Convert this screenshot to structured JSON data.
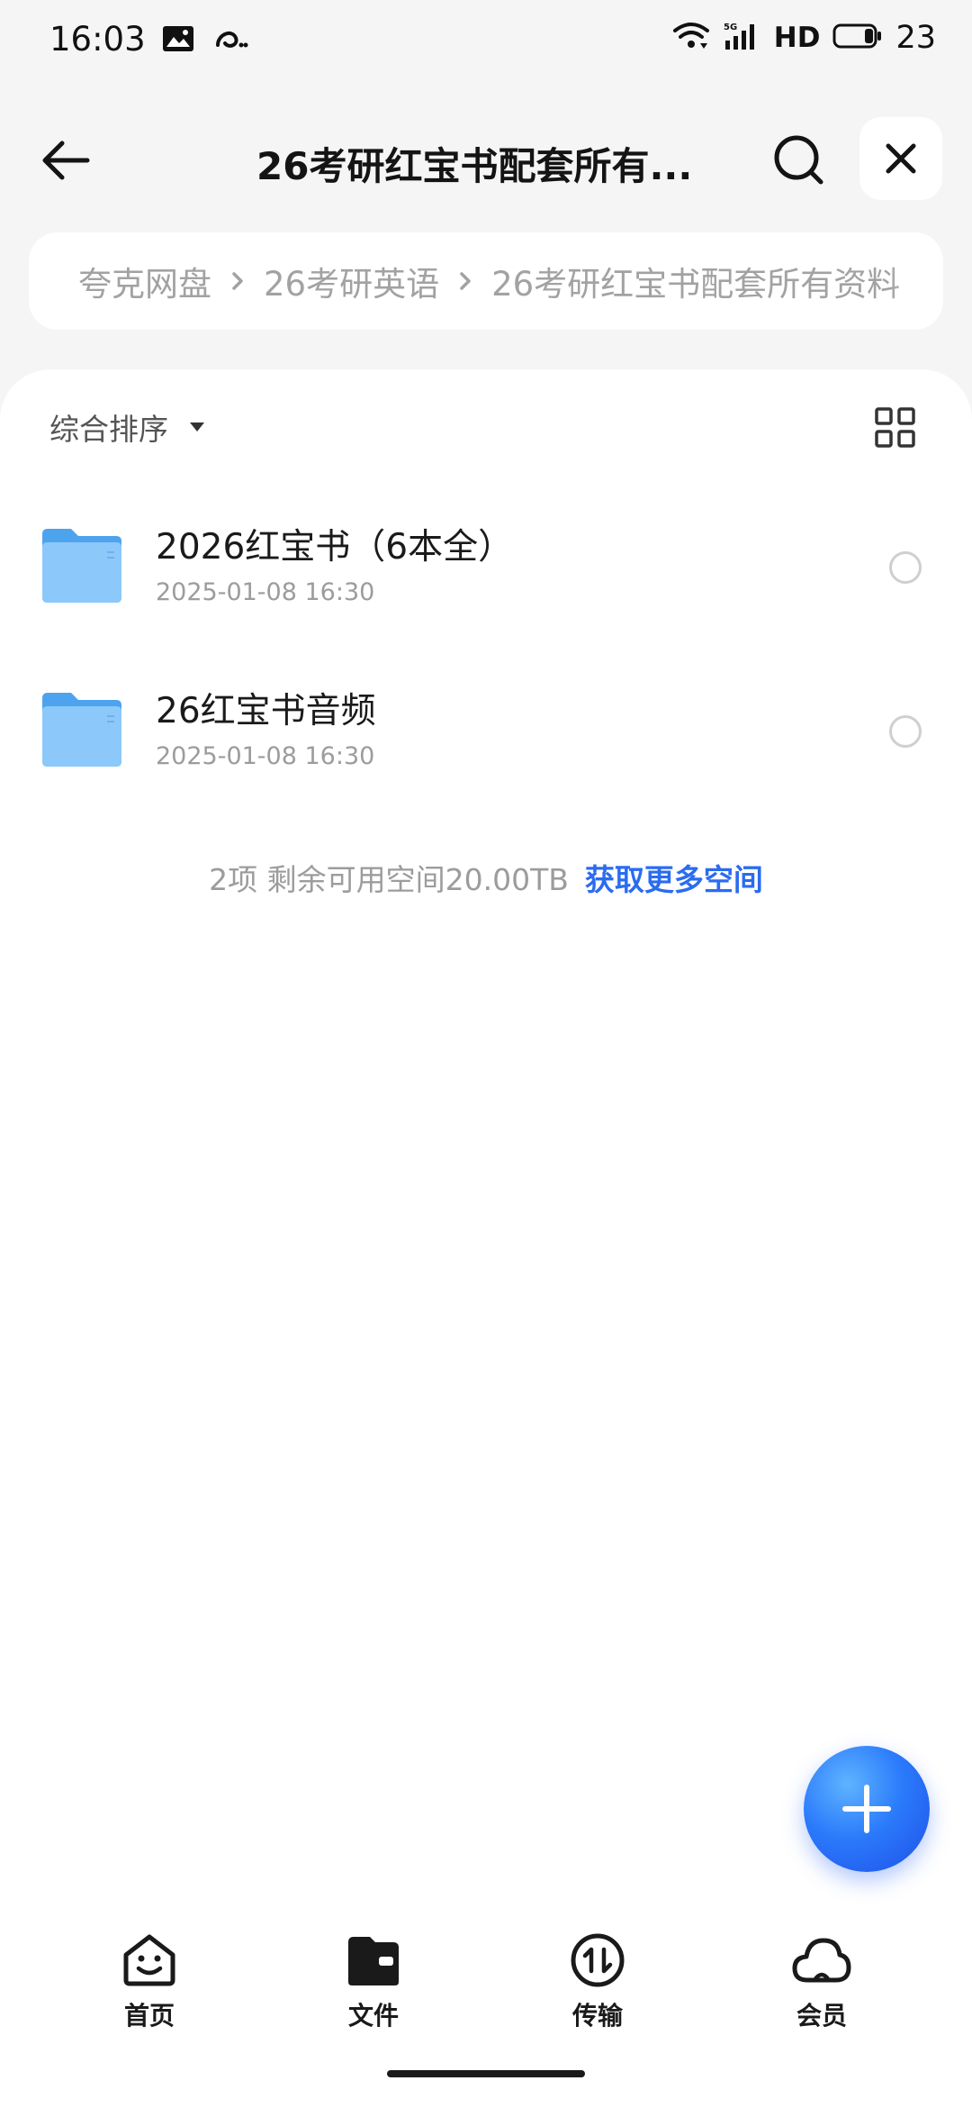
{
  "status_bar": {
    "time": "16:03",
    "network_label": "5G",
    "hd_label": "HD",
    "battery": "23"
  },
  "header": {
    "title": "26考研红宝书配套所有...",
    "back_icon": "arrow-left-icon",
    "search_icon": "search-icon",
    "close_icon": "close-icon"
  },
  "breadcrumb": {
    "items": [
      "夸克网盘",
      "26考研英语",
      "26考研红宝书配套所有资料"
    ]
  },
  "toolbar": {
    "sort_label": "综合排序"
  },
  "files": [
    {
      "name": "2026红宝书（6本全）",
      "date": "2025-01-08 16:30",
      "type": "folder"
    },
    {
      "name": "26红宝书音频",
      "date": "2025-01-08 16:30",
      "type": "folder"
    }
  ],
  "storage": {
    "info": "2项 剩余可用空间20.00TB",
    "link": "获取更多空间"
  },
  "bottom_nav": [
    {
      "label": "首页",
      "icon": "smiley-home-icon"
    },
    {
      "label": "文件",
      "icon": "wallet-folder-icon"
    },
    {
      "label": "传输",
      "icon": "transfer-icon"
    },
    {
      "label": "会员",
      "icon": "cloud-icon"
    }
  ],
  "colors": {
    "accent": "#2a6cf0",
    "folder": "#6fb5f5",
    "background": "#f5f5f6"
  }
}
